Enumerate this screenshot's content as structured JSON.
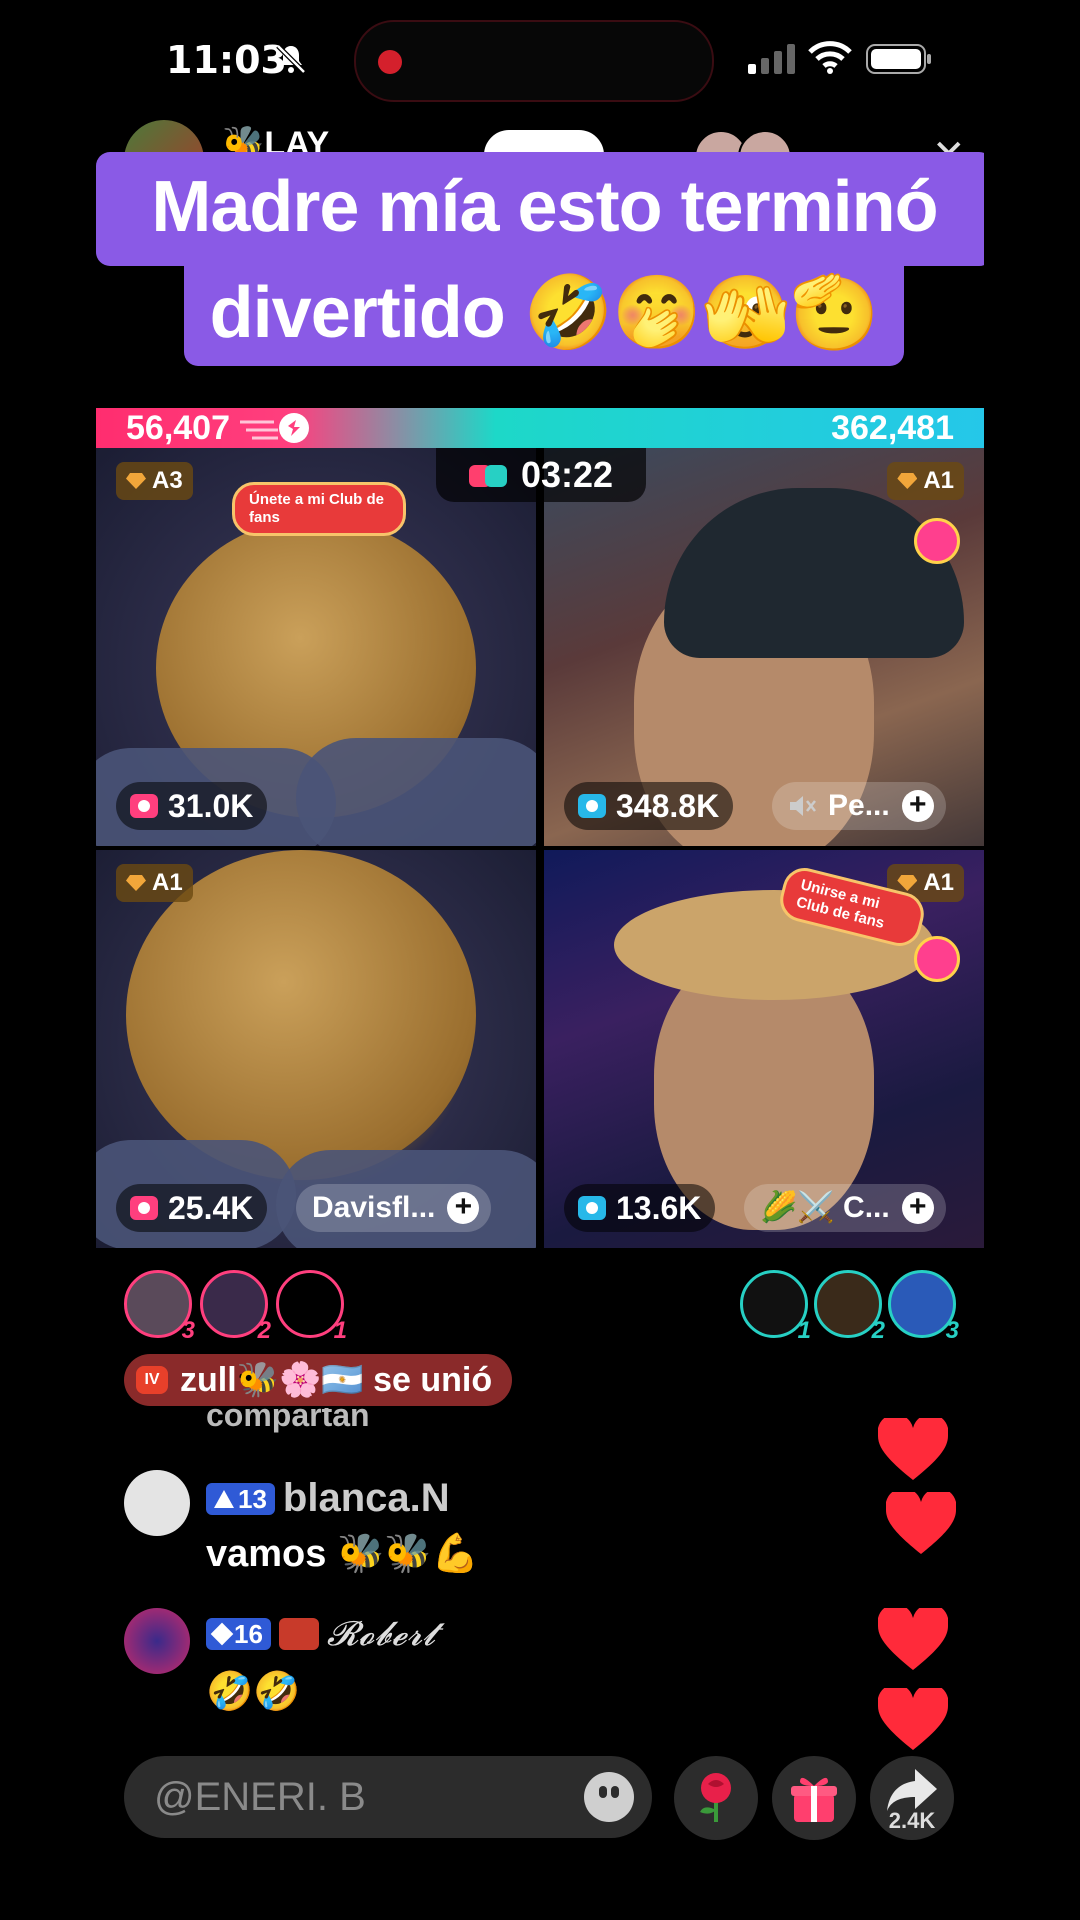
{
  "status_bar": {
    "time": "11:03"
  },
  "host": {
    "name": "🐝LAY"
  },
  "caption": {
    "line1": "Madre mía esto terminó",
    "line2": "divertido 🤣🤭🫣🫡"
  },
  "battle": {
    "left_score": "56,407",
    "right_score": "362,481",
    "timer": "03:22"
  },
  "tiles": [
    {
      "rank": "A3",
      "fan_badge": "Únete a mi Club de fans",
      "score": "31.0K"
    },
    {
      "rank": "A1",
      "score": "348.8K",
      "name": "Pe..."
    },
    {
      "rank": "A1",
      "score": "25.4K",
      "name": "Davisfl..."
    },
    {
      "rank": "A1",
      "fan_badge": "Unirse a mi Club de fans",
      "score": "13.6K",
      "name": "🌽⚔️ C..."
    }
  ],
  "supporters_left": [
    "3",
    "2",
    "1"
  ],
  "supporters_right": [
    "1",
    "2",
    "3"
  ],
  "joined": {
    "text": "zull🐝🌸🇦🇷 se unió",
    "badge": "IV"
  },
  "ghost_comment": "compartan",
  "comments": [
    {
      "level": "13",
      "user": "blanca.N",
      "message": "vamos 🐝🐝💪"
    },
    {
      "level": "16",
      "user": "𝓡𝓸𝓫𝓮𝓻𝓽",
      "message": "🤣🤣"
    }
  ],
  "input": {
    "placeholder": "@ENERI. B"
  },
  "share_count": "2.4K",
  "colors": {
    "caption_bg": "#8a5ae6",
    "red_team": "#ff3f7e",
    "blue_team": "#27d0c4",
    "heart": "#ff2a3a"
  },
  "icons": [
    "bell-slash-icon",
    "signal-icon",
    "wifi-icon",
    "battery-icon",
    "close-icon",
    "boxing-gloves-icon",
    "gem-icon",
    "camera-icon",
    "plus-icon",
    "emoji-icon",
    "rose-icon",
    "gift-icon",
    "share-icon",
    "heart-icon"
  ]
}
